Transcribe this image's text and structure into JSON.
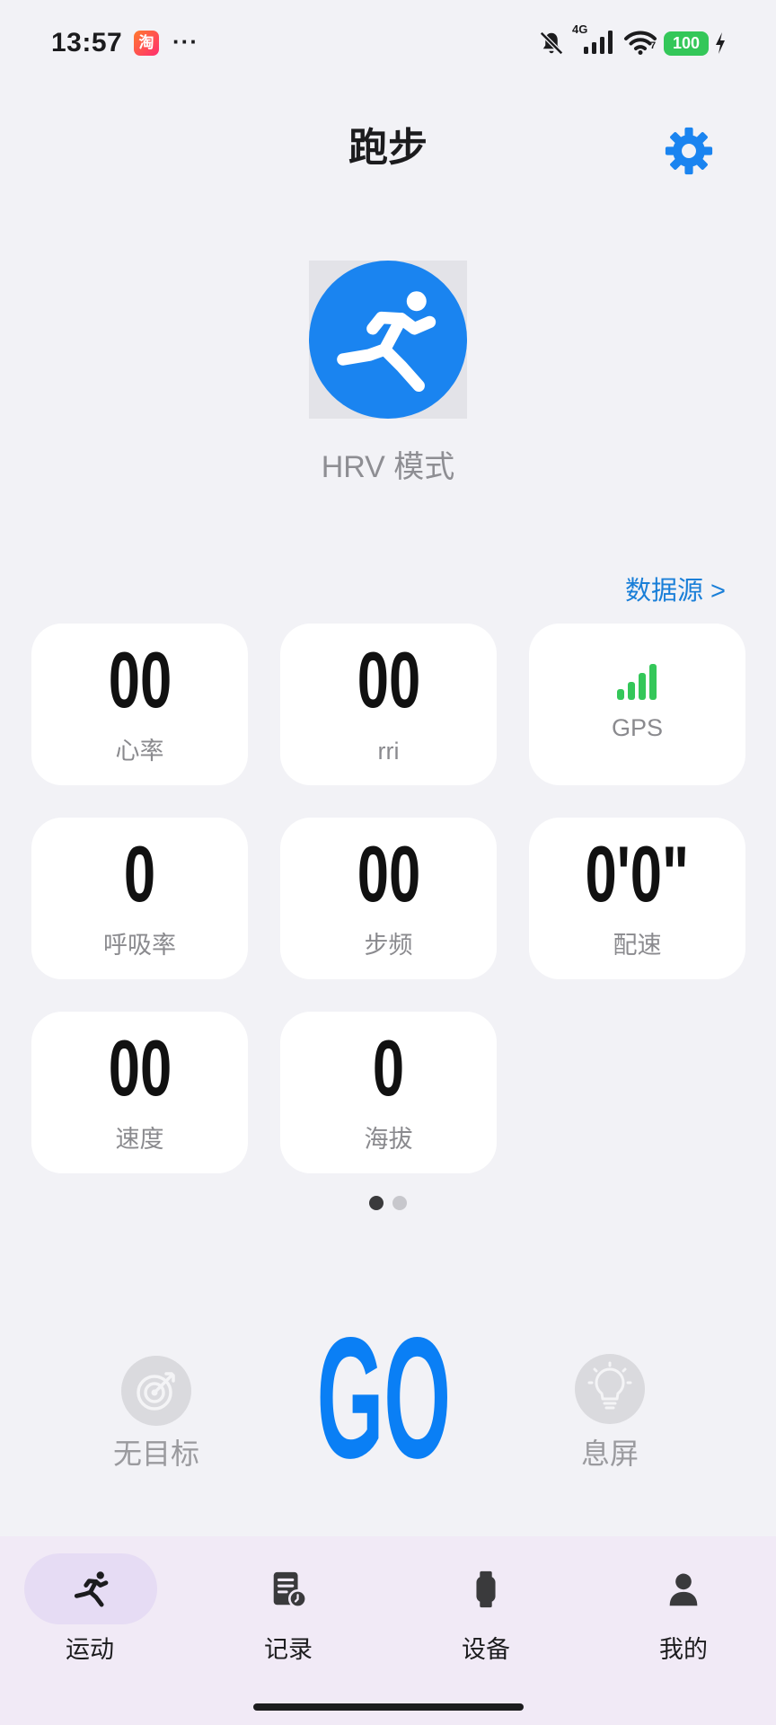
{
  "status_bar": {
    "time": "13:57",
    "app_icon": "taobao-icon",
    "app_icon_text": "淘",
    "overflow": "···",
    "mute_icon": "bell-muted-icon",
    "network_type": "4G",
    "signal_icon": "cellular-signal-icon",
    "wifi_icon": "wifi-icon",
    "wifi_badge": "7",
    "battery_level": "100",
    "charging_icon": "charging-bolt-icon"
  },
  "header": {
    "title": "跑步",
    "settings_icon": "gear-icon"
  },
  "mode": {
    "icon": "running-icon",
    "label": "HRV 模式"
  },
  "data_source": {
    "label": "数据源 >"
  },
  "metrics": [
    {
      "value": "00",
      "label": "心率"
    },
    {
      "value": "00",
      "label": "rri"
    },
    {
      "icon": "gps-signal-icon",
      "label": "GPS"
    },
    {
      "value": "0",
      "label": "呼吸率"
    },
    {
      "value": "00",
      "label": "步频"
    },
    {
      "value": "0'0\"",
      "label": "配速"
    },
    {
      "value": "00",
      "label": "速度"
    },
    {
      "value": "0",
      "label": "海拔"
    }
  ],
  "pager": {
    "total": 2,
    "current": 1
  },
  "controls": {
    "goal": {
      "icon": "target-icon",
      "label": "无目标"
    },
    "start": {
      "label": "GO"
    },
    "screen_off": {
      "icon": "lightbulb-icon",
      "label": "息屏"
    }
  },
  "tab_bar": {
    "active_index": 0,
    "tabs": [
      {
        "label": "运动",
        "icon": "running-icon"
      },
      {
        "label": "记录",
        "icon": "record-icon"
      },
      {
        "label": "设备",
        "icon": "watch-icon"
      },
      {
        "label": "我的",
        "icon": "profile-icon"
      }
    ]
  },
  "colors": {
    "accent": "#1a84f0",
    "go_text": "#0a7ff5",
    "gps_signal": "#34c759",
    "battery": "#34c759",
    "page_background": "#f2f2f6",
    "tab_bar_background": "#f1eaf6",
    "active_tab_pill": "#e6dcf4"
  }
}
